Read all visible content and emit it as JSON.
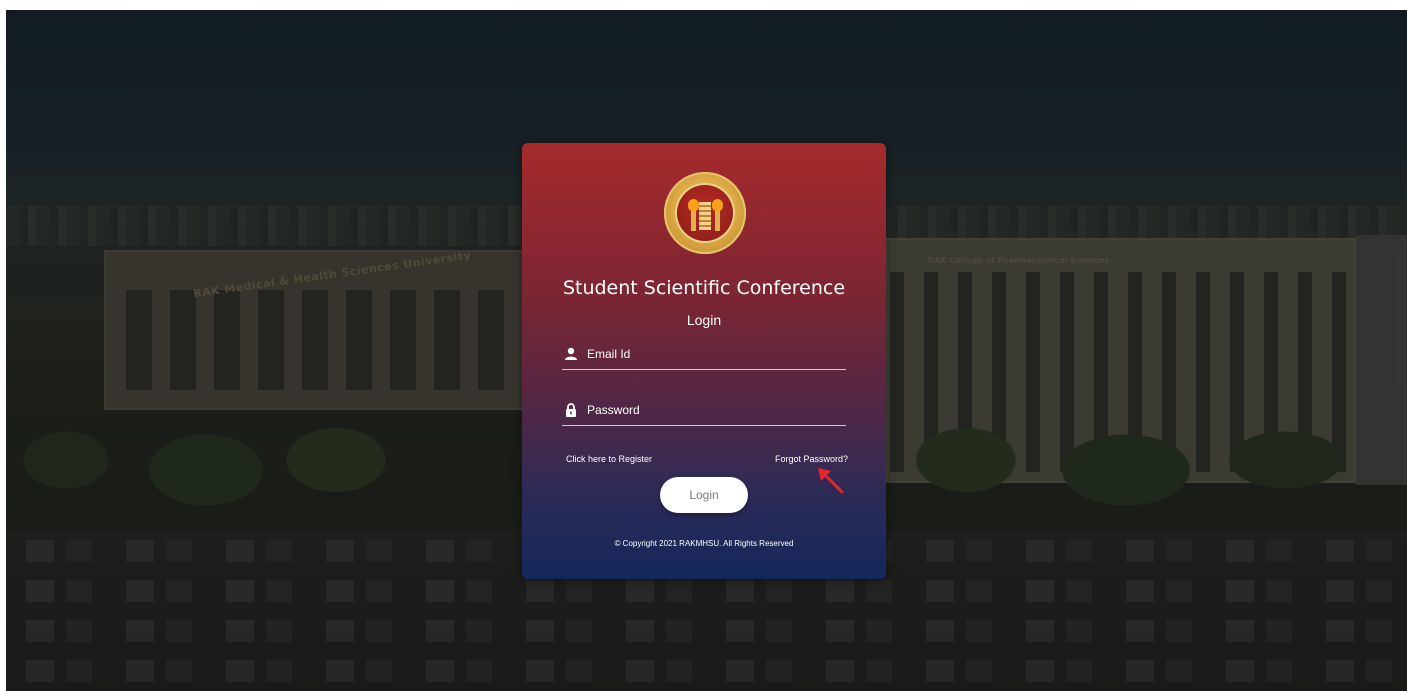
{
  "login_card": {
    "logo_icon": "university-seal-icon",
    "title": "Student Scientific Conference",
    "subtitle": "Login",
    "email_field": {
      "placeholder": "Email Id",
      "value": "",
      "icon": "user-icon"
    },
    "password_field": {
      "placeholder": "Password",
      "value": "",
      "icon": "lock-icon"
    },
    "register_link": "Click here to Register",
    "forgot_link": "Forgot Password?",
    "login_button": "Login",
    "copyright": "© Copyright 2021 RAKMHSU. All Rights Reserved"
  },
  "background": {
    "building_left_sign": "RAK Medical & Health Sciences University",
    "building_right_sign": "RAK College of Pharmaceutical Sciences"
  },
  "annotation": {
    "type": "red-arrow-icon",
    "color": "#e3262c"
  },
  "colors": {
    "card_top": "#a62a2c",
    "card_bottom": "#14275a",
    "button_bg": "#ffffff"
  }
}
